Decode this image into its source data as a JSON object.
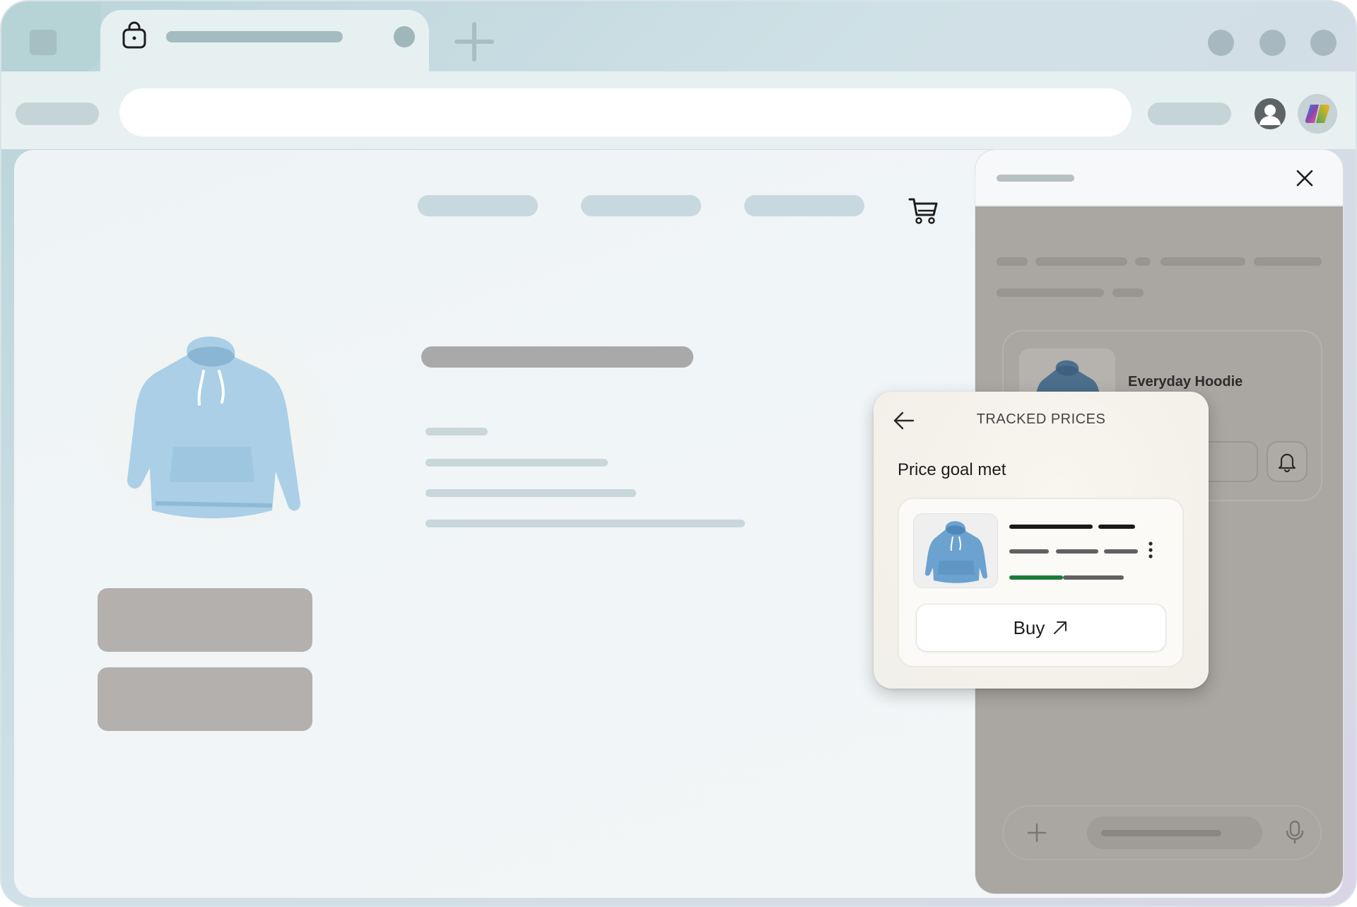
{
  "browser": {
    "tabs": [
      {
        "kind": "inactive"
      },
      {
        "kind": "active",
        "icon": "shopping-bag-icon"
      }
    ],
    "new_tab_icon": "plus-icon",
    "toolbar_icons": [
      "profile-icon",
      "copilot-icon"
    ]
  },
  "page": {
    "icons": [
      "cart-icon"
    ]
  },
  "copilot_panel": {
    "close_icon": "close-icon",
    "card": {
      "product_name": "Everyday Hoodie",
      "alert_icon": "bell-icon"
    },
    "composer": {
      "add_icon": "plus-icon",
      "mic_icon": "microphone-icon"
    }
  },
  "tracked_prices_popup": {
    "title": "TRACKED PRICES",
    "back_icon": "arrow-left-icon",
    "section_heading": "Price goal met",
    "product": {
      "image": "blue-hoodie",
      "more_icon": "more-vertical-icon"
    },
    "buy_label": "Buy",
    "buy_icon": "external-arrow-icon"
  },
  "colors": {
    "accent_green": "#1f7a3a",
    "hoodie_blue": "#a9cde6",
    "panel_dim": "#aaa6a1"
  }
}
